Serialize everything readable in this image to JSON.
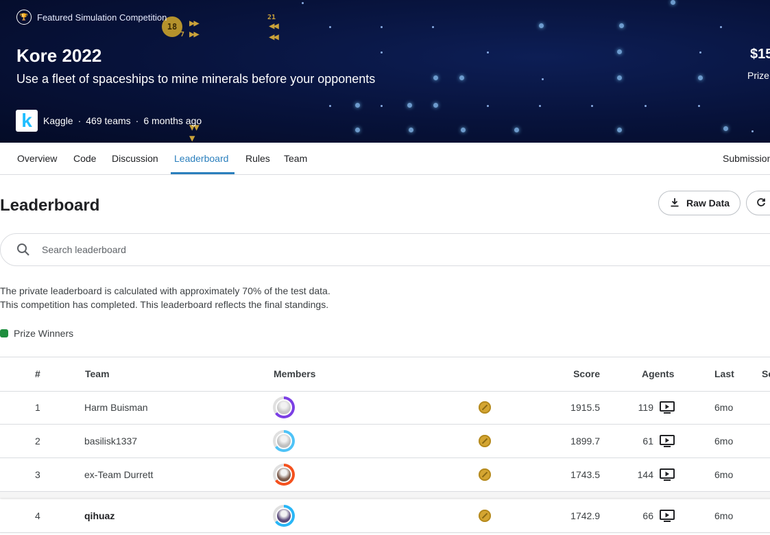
{
  "banner": {
    "category": "Featured Simulation Competition",
    "title": "Kore 2022",
    "subtitle": "Use a fleet of spaceships to mine minerals before your opponents",
    "host": "Kaggle",
    "teams": "469 teams",
    "time": "6 months ago",
    "prize_amount": "$15",
    "prize_label": "Prize",
    "game_labels": [
      "18",
      "7",
      "21"
    ]
  },
  "tabs": [
    "Overview",
    "Code",
    "Discussion",
    "Leaderboard",
    "Rules",
    "Team",
    "Submissions"
  ],
  "active_tab": "Leaderboard",
  "leaderboard": {
    "title": "Leaderboard",
    "raw_data_label": "Raw Data",
    "search_placeholder": "Search leaderboard",
    "info_line1": "The private leaderboard is calculated with approximately 70% of the test data.",
    "info_line2": "This competition has completed. This leaderboard reflects the final standings.",
    "legend_label": "Prize Winners",
    "legend_color": "#1e8e3e",
    "columns": [
      "#",
      "Team",
      "Members",
      "Score",
      "Agents",
      "Last",
      "Sc"
    ],
    "rows": [
      {
        "rank": "1",
        "team": "Harm Buisman",
        "score": "1915.5",
        "agents": "119",
        "last": "6mo",
        "ring": "#7b3fe4"
      },
      {
        "rank": "2",
        "team": "basilisk1337",
        "score": "1899.7",
        "agents": "61",
        "last": "6mo",
        "ring": "#4fc3f7"
      },
      {
        "rank": "3",
        "team": "ex-Team Durrett",
        "score": "1743.5",
        "agents": "144",
        "last": "6mo",
        "ring": "#f4511e"
      },
      {
        "rank": "4",
        "team": "qihuaz",
        "score": "1742.9",
        "agents": "66",
        "last": "6mo",
        "ring": "#29b6f6"
      }
    ]
  },
  "colors": {
    "accent": "#2a7fbd",
    "medal_gold": "#d4a531",
    "banner_bg": "#07123a"
  }
}
